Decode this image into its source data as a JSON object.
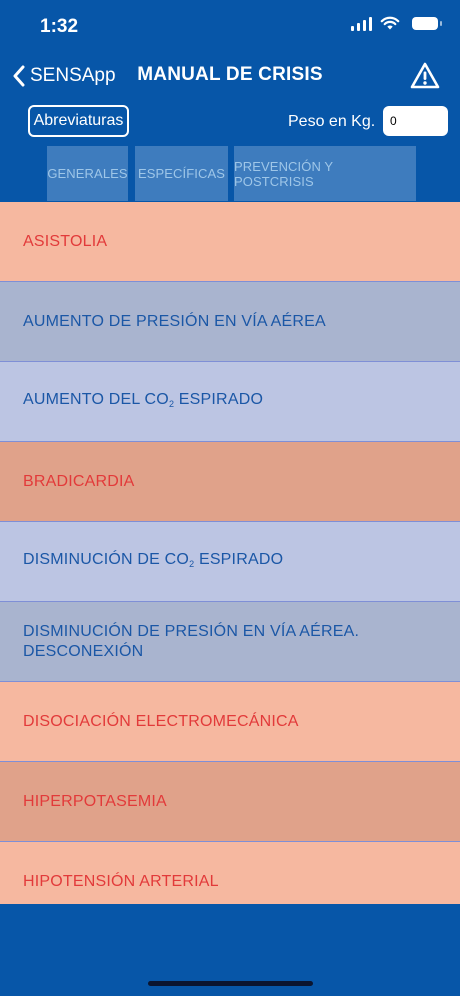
{
  "status": {
    "time": "1:32"
  },
  "nav": {
    "back_label": "SENSApp",
    "title": "MANUAL DE CRISIS",
    "alert_icon": "warning-triangle-icon"
  },
  "toolbar": {
    "abbrev_label": "Abreviaturas",
    "weight_label": "Peso en Kg.",
    "weight_value": "0"
  },
  "tabs": [
    "GENERALES",
    "ESPECÍFICAS",
    "PREVENCIÓN Y POSTCRISIS"
  ],
  "rows": [
    {
      "text": "ASISTOLIA",
      "color": "#f6b8a0",
      "kind": "red"
    },
    {
      "text": "AUMENTO DE PRESIÓN EN VÍA AÉREA",
      "color": "#a9b4cf",
      "kind": "blue"
    },
    {
      "text_before": "AUMENTO DEL CO",
      "sub": "2",
      "text_after": " ESPIRADO",
      "color": "#bcc5e3",
      "kind": "blue"
    },
    {
      "text": "BRADICARDIA",
      "color": "#e0a28a",
      "kind": "red"
    },
    {
      "text_before": "DISMINUCIÓN DE CO",
      "sub": "2",
      "text_after": " ESPIRADO",
      "color": "#bcc5e3",
      "kind": "blue"
    },
    {
      "text": "DISMINUCIÓN DE PRESIÓN EN VÍA AÉREA.\nDESCONEXIÓN",
      "color": "#a9b4cf",
      "kind": "blue"
    },
    {
      "text": "DISOCIACIÓN ELECTROMECÁNICA",
      "color": "#f6b8a0",
      "kind": "red"
    },
    {
      "text": "HIPERPOTASEMIA",
      "color": "#e0a28a",
      "kind": "red"
    },
    {
      "text": "HIPOTENSIÓN ARTERIAL",
      "color": "#f6b8a0",
      "kind": "red"
    }
  ],
  "colors": {
    "background": "#0756a8",
    "tab": "#3e7cbe",
    "tab_text": "#9ec6e8"
  }
}
